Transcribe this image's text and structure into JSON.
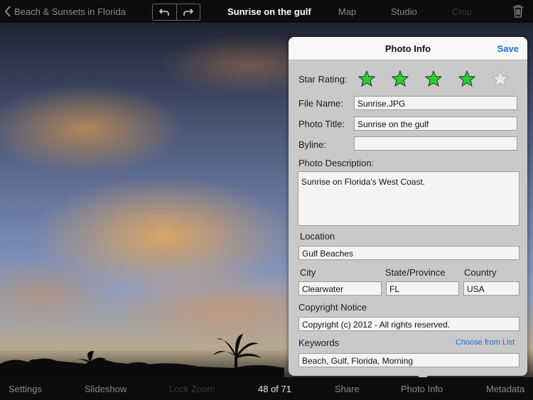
{
  "topbar": {
    "back_label": "Beach & Sunsets in Florida",
    "title": "Sunrise on the gulf",
    "tabs": [
      {
        "label": "Map",
        "enabled": true
      },
      {
        "label": "Studio",
        "enabled": true
      },
      {
        "label": "Crop",
        "enabled": false
      }
    ],
    "icons": [
      "chevron-left-icon",
      "undo-icon",
      "redo-icon",
      "trash-icon"
    ]
  },
  "photo_info": {
    "title": "Photo Info",
    "save_label": "Save",
    "star_rating_label": "Star Rating:",
    "star_rating": 4,
    "star_max": 5,
    "file_name_label": "File Name:",
    "file_name": "Sunrise.JPG",
    "photo_title_label": "Photo Title:",
    "photo_title": "Sunrise on the gulf",
    "byline_label": "Byline:",
    "byline": "",
    "description_label": "Photo Description:",
    "description": "Sunrise on Florida's West Coast.",
    "location_label": "Location",
    "location": "Gulf Beaches",
    "city_label": "City",
    "city": "Clearwater",
    "state_label": "State/Province",
    "state": "FL",
    "country_label": "Country",
    "country": "USA",
    "copyright_label": "Copyright Notice",
    "copyright": "Copyright (c) 2012 - All rights reserved.",
    "keywords_label": "Keywords",
    "choose_from_list_label": "Choose from List",
    "keywords": "Beach, Gulf, Florida, Morning"
  },
  "bottombar": {
    "settings": "Settings",
    "slideshow": "Slideshow",
    "lock_zoom": "Lock Zoom",
    "counter": "48 of 71",
    "share": "Share",
    "photo_info": "Photo Info",
    "metadata": "Metadata"
  },
  "colors": {
    "star_filled": "#22d42a",
    "star_empty": "#e8e8e8",
    "accent": "#1a73d9",
    "bar_bg": "#0c0c0c"
  }
}
